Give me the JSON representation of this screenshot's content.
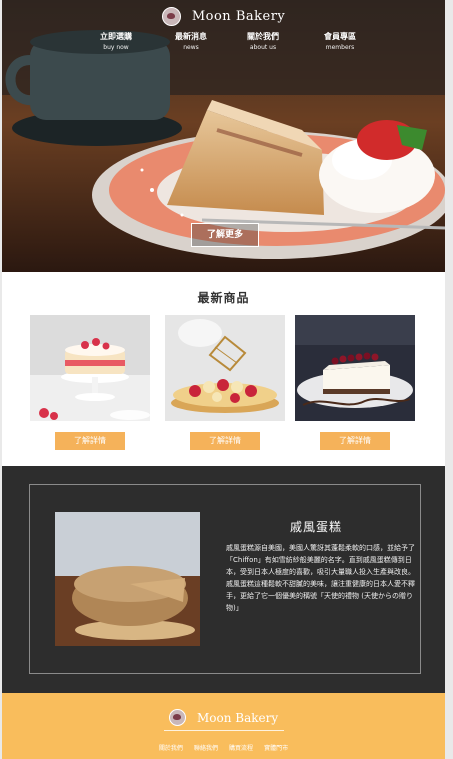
{
  "brand": {
    "name": "Moon Bakery"
  },
  "nav": [
    {
      "zh": "立即選購",
      "en": "buy now"
    },
    {
      "zh": "最新消息",
      "en": "news"
    },
    {
      "zh": "關於我們",
      "en": "about us"
    },
    {
      "zh": "會員專區",
      "en": "members"
    }
  ],
  "hero": {
    "button_label": "了解更多"
  },
  "products": {
    "title": "最新商品",
    "items": [
      {
        "button_label": "了解詳情"
      },
      {
        "button_label": "了解詳情"
      },
      {
        "button_label": "了解詳情"
      }
    ]
  },
  "feature": {
    "title": "戚風蛋糕",
    "paragraph1": "戚風蛋糕源自美國，美國人驚訝其蓬鬆柔軟的口感，並給予了「Chiffon」有如雪紡紗般美麗的名字。直到戚風蛋糕傳到日本，受到日本人極度的喜歡，吸引大量職人投入生產與改良。",
    "paragraph2": "戚風蛋糕這種鬆軟不甜膩的美味，讓注重健康的日本人愛不釋手，更給了它一個優美的稱號「天使的禮物 (天使からの贈り物)」"
  },
  "footer": {
    "brand_name": "Moon Bakery",
    "links": [
      "關於我們",
      "聯絡我們",
      "購買流程",
      "實體門市"
    ]
  },
  "colors": {
    "accent": "#f5b25a",
    "footer_bg": "#f9bd5c",
    "dark_section": "#2d2d2d"
  }
}
